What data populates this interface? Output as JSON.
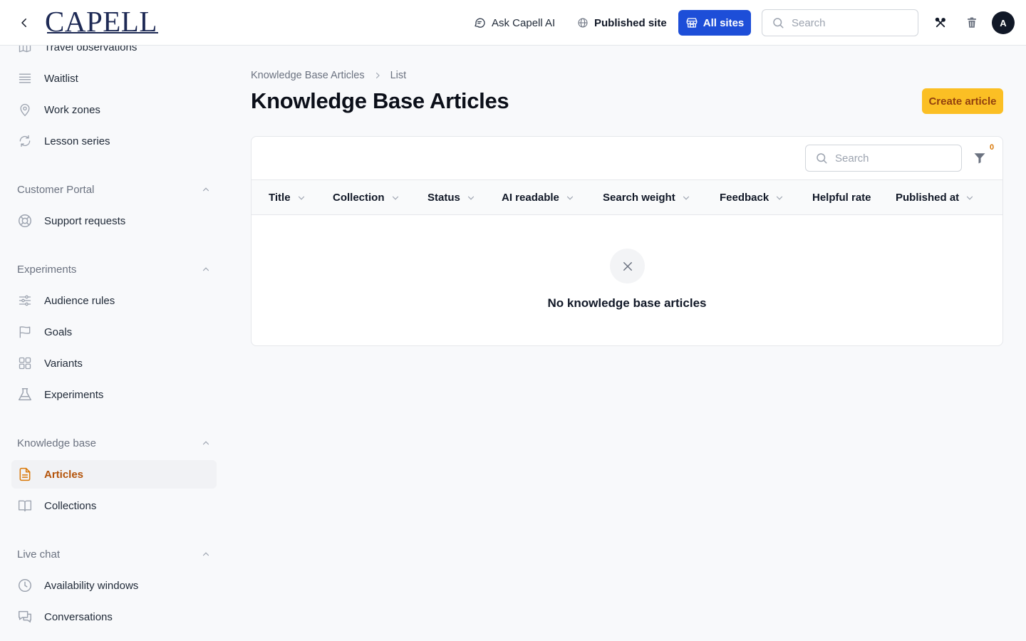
{
  "header": {
    "logo_text": "CAPELL",
    "ask_ai_label": "Ask Capell AI",
    "published_site_label": "Published site",
    "all_sites_label": "All sites",
    "search_placeholder": "Search",
    "avatar_initial": "A"
  },
  "sidebar": {
    "top_items": [
      {
        "label": "Travel observations",
        "icon": "map-icon"
      },
      {
        "label": "Waitlist",
        "icon": "list-icon"
      },
      {
        "label": "Work zones",
        "icon": "map-pin-icon"
      },
      {
        "label": "Lesson series",
        "icon": "repeat-icon"
      }
    ],
    "sections": [
      {
        "title": "Customer Portal",
        "items": [
          {
            "label": "Support requests",
            "icon": "lifebuoy-icon"
          }
        ]
      },
      {
        "title": "Experiments",
        "items": [
          {
            "label": "Audience rules",
            "icon": "sliders-icon"
          },
          {
            "label": "Goals",
            "icon": "flag-icon"
          },
          {
            "label": "Variants",
            "icon": "grid-icon"
          },
          {
            "label": "Experiments",
            "icon": "beaker-icon"
          }
        ]
      },
      {
        "title": "Knowledge base",
        "items": [
          {
            "label": "Articles",
            "icon": "document-icon",
            "active": true
          },
          {
            "label": "Collections",
            "icon": "book-icon"
          }
        ]
      },
      {
        "title": "Live chat",
        "items": [
          {
            "label": "Availability windows",
            "icon": "clock-icon"
          },
          {
            "label": "Conversations",
            "icon": "chat-icon"
          }
        ]
      }
    ]
  },
  "main": {
    "breadcrumb": [
      "Knowledge Base Articles",
      "List"
    ],
    "title": "Knowledge Base Articles",
    "create_label": "Create article",
    "table": {
      "search_placeholder": "Search",
      "filter_count": "0",
      "columns": [
        "Title",
        "Collection",
        "Status",
        "AI readable",
        "Search weight",
        "Feedback",
        "Helpful rate",
        "Published at"
      ],
      "empty_text": "No knowledge base articles"
    }
  },
  "colors": {
    "accent": "#fbbf24",
    "active_text": "#b45309",
    "primary": "#1d4ed8",
    "logo": "#1e2a55"
  }
}
